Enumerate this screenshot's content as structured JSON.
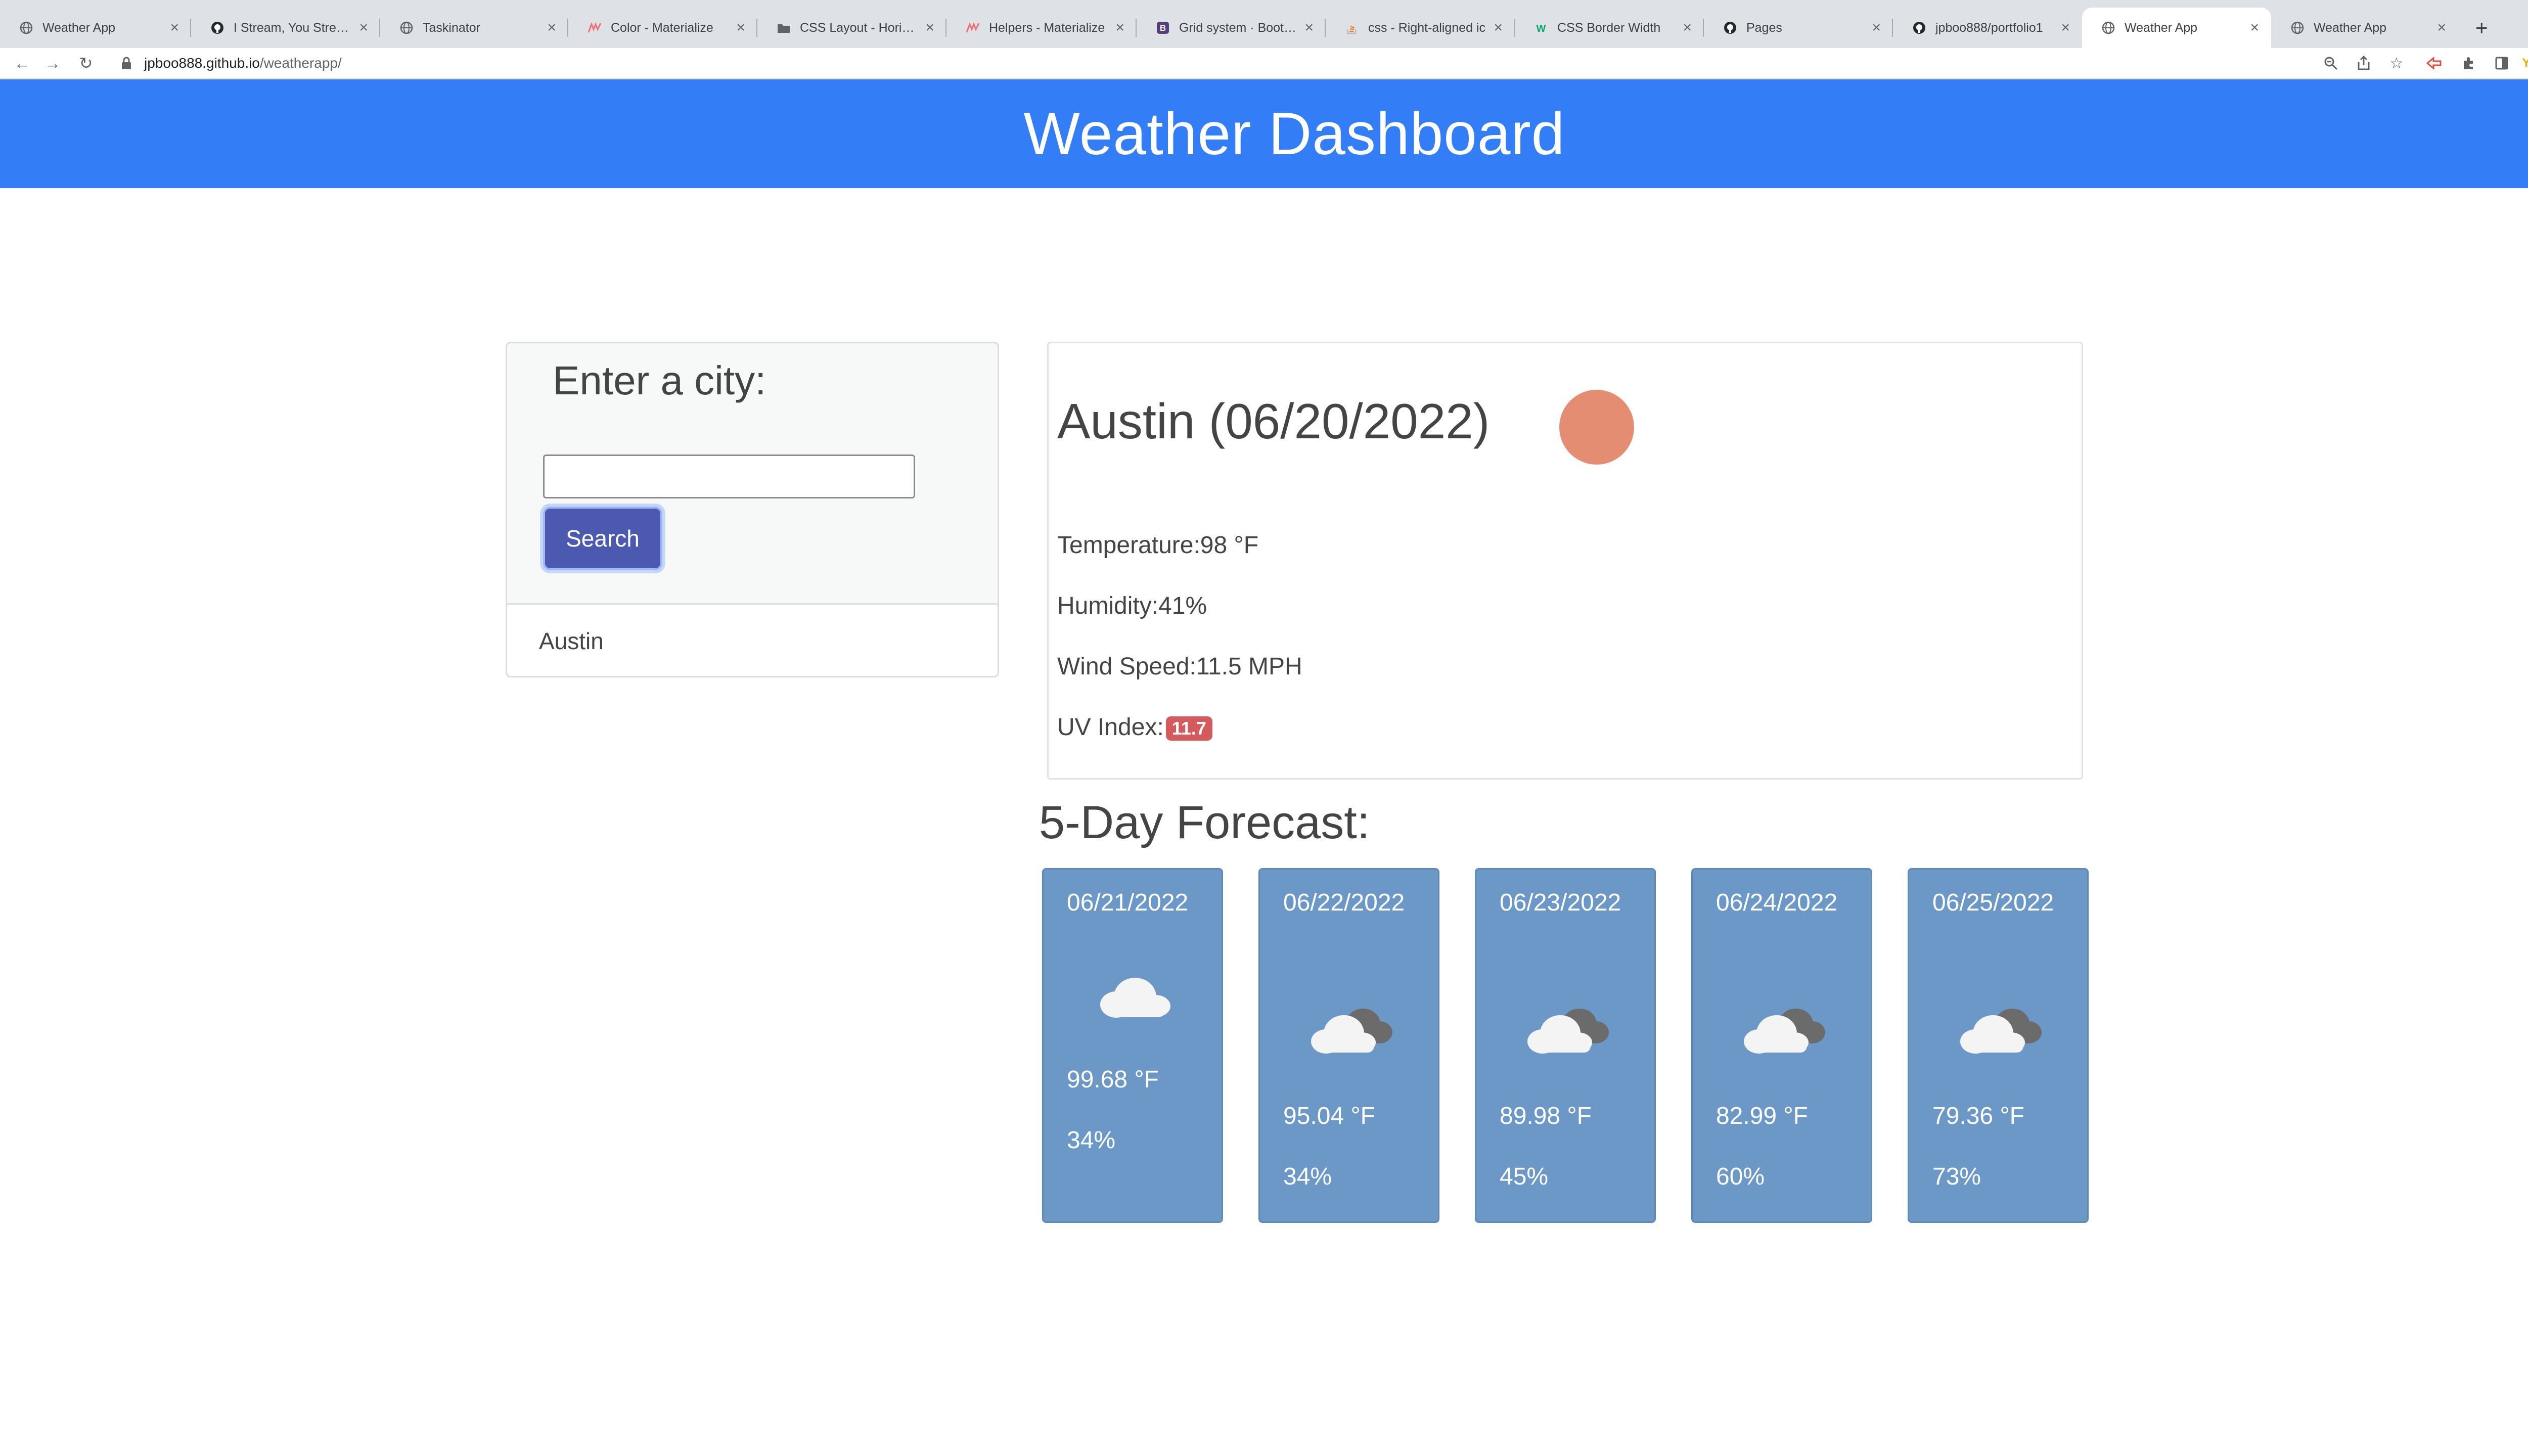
{
  "browser": {
    "tabs": [
      {
        "title": "Weather App",
        "icon": "globe-icon"
      },
      {
        "title": "I Stream, You Stream",
        "icon": "github-icon"
      },
      {
        "title": "Taskinator",
        "icon": "globe-icon"
      },
      {
        "title": "Color - Materialize",
        "icon": "materialize-icon"
      },
      {
        "title": "CSS Layout - Horizon",
        "icon": "folder-icon"
      },
      {
        "title": "Helpers - Materialize",
        "icon": "materialize-icon"
      },
      {
        "title": "Grid system · Bootstr",
        "icon": "bootstrap-icon"
      },
      {
        "title": "css - Right-aligned ic",
        "icon": "stackoverflow-icon"
      },
      {
        "title": "CSS Border Width",
        "icon": "w3schools-icon"
      },
      {
        "title": "Pages",
        "icon": "github-icon"
      },
      {
        "title": "jpboo888/portfolio1",
        "icon": "github-icon"
      },
      {
        "title": "Weather App",
        "icon": "globe-icon"
      },
      {
        "title": "Weather App",
        "icon": "globe-icon"
      }
    ],
    "active_tab": 11,
    "url_host": "jpboo888.github.io",
    "url_path": "/weatherapp/",
    "extension_label": "YTX"
  },
  "header": {
    "title": "Weather Dashboard"
  },
  "search": {
    "heading": "Enter a city:",
    "input_value": "",
    "button_label": "Search",
    "history": [
      "Austin"
    ]
  },
  "current": {
    "city_line": "Austin (06/20/2022)",
    "icon_color": "#e58d73",
    "temperature_label": "Temperature:",
    "temperature_value": "98 °F",
    "humidity_label": "Humidity:",
    "humidity_value": "41%",
    "wind_label": "Wind Speed:",
    "wind_value": "11.5 MPH",
    "uv_label": "UV Index:",
    "uv_value": "11.7",
    "uv_color": "#d55a5d"
  },
  "forecast": {
    "title": "5-Day Forecast:",
    "card_color": "#6c98c8",
    "days": [
      {
        "date": "06/21/2022",
        "icon": "cloud-icon",
        "temp": "99.68 °F",
        "humidity": "34%"
      },
      {
        "date": "06/22/2022",
        "icon": "broken-clouds-icon",
        "temp": "95.04 °F",
        "humidity": "34%"
      },
      {
        "date": "06/23/2022",
        "icon": "broken-clouds-icon",
        "temp": "89.98 °F",
        "humidity": "45%"
      },
      {
        "date": "06/24/2022",
        "icon": "broken-clouds-icon",
        "temp": "82.99 °F",
        "humidity": "60%"
      },
      {
        "date": "06/25/2022",
        "icon": "broken-clouds-icon",
        "temp": "79.36 °F",
        "humidity": "73%"
      }
    ]
  },
  "colors": {
    "header_bg": "#337ef6",
    "search_button": "#4b5ab0"
  }
}
